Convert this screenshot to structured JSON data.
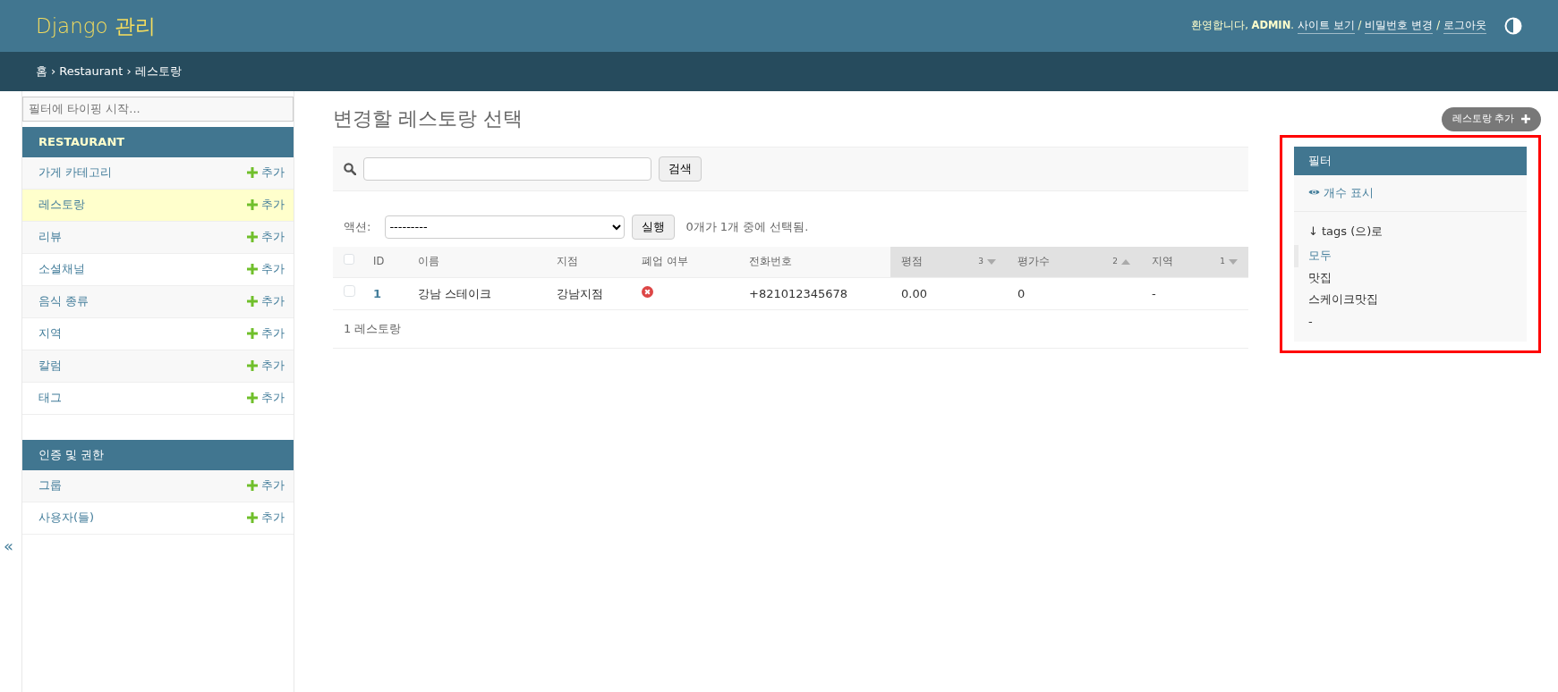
{
  "header": {
    "title": "Django 관리",
    "welcome": "환영합니다, **ADMIN**.",
    "links": [
      "사이트 보기",
      "비밀번호 변경",
      "로그아웃"
    ],
    "separator": "/"
  },
  "breadcrumbs": {
    "items": [
      "홈",
      "Restaurant",
      "레스토랑"
    ],
    "separator": "›"
  },
  "sidebar": {
    "filter_placeholder": "필터에 타이핑 시작...",
    "collapse_toggle": "«",
    "apps": [
      {
        "name": "RESTAURANT",
        "models": [
          {
            "name": "가게 카테고리",
            "add": "추가",
            "selected": false
          },
          {
            "name": "레스토랑",
            "add": "추가",
            "selected": true
          },
          {
            "name": "리뷰",
            "add": "추가",
            "selected": false
          },
          {
            "name": "소셜채널",
            "add": "추가",
            "selected": false
          },
          {
            "name": "음식 종류",
            "add": "추가",
            "selected": false
          },
          {
            "name": "지역",
            "add": "추가",
            "selected": false
          },
          {
            "name": "칼럼",
            "add": "추가",
            "selected": false
          },
          {
            "name": "태그",
            "add": "추가",
            "selected": false
          }
        ]
      },
      {
        "name": "인증 및 권한",
        "models": [
          {
            "name": "그룹",
            "add": "추가",
            "selected": false
          },
          {
            "name": "사용자(들)",
            "add": "추가",
            "selected": false
          }
        ]
      }
    ]
  },
  "main": {
    "title": "변경할 레스토랑 선택",
    "add_button": "레스토랑 추가",
    "search": {
      "button": "검색"
    },
    "actions": {
      "label": "액션:",
      "value": "---------",
      "run": "실행",
      "counter": "0개가 1개 중에 선택됨."
    },
    "table": {
      "columns": [
        {
          "label": "ID",
          "sorted": false
        },
        {
          "label": "이름",
          "sorted": false
        },
        {
          "label": "지점",
          "sorted": false
        },
        {
          "label": "폐업 여부",
          "sorted": false
        },
        {
          "label": "전화번호",
          "sorted": false
        },
        {
          "label": "평점",
          "sorted": true,
          "priority": "3",
          "ascending": false
        },
        {
          "label": "평가수",
          "sorted": true,
          "priority": "2",
          "ascending": true
        },
        {
          "label": "지역",
          "sorted": true,
          "priority": "1",
          "ascending": false
        }
      ],
      "select_all_checked": false,
      "rows": [
        {
          "checked": false,
          "cells": [
            {
              "kind": "link",
              "text": "1"
            },
            {
              "kind": "text",
              "text": "강남 스테이크"
            },
            {
              "kind": "text",
              "text": "강남지점"
            },
            {
              "kind": "boolean",
              "value": false
            },
            {
              "kind": "text",
              "text": "+821012345678"
            },
            {
              "kind": "text",
              "text": "0.00"
            },
            {
              "kind": "text",
              "text": "0"
            },
            {
              "kind": "text",
              "text": "-"
            }
          ]
        }
      ]
    },
    "result_count": "1 레스토랑"
  },
  "filter": {
    "highlighted": true,
    "title": "필터",
    "show_counts": "개수 표시",
    "groups": [
      {
        "title": "↓ tags (으)로",
        "choices": [
          {
            "label": "모두",
            "selected": true
          },
          {
            "label": "맛집",
            "selected": false
          },
          {
            "label": "스케이크맛집",
            "selected": false
          },
          {
            "label": "-",
            "selected": false
          }
        ]
      }
    ]
  }
}
